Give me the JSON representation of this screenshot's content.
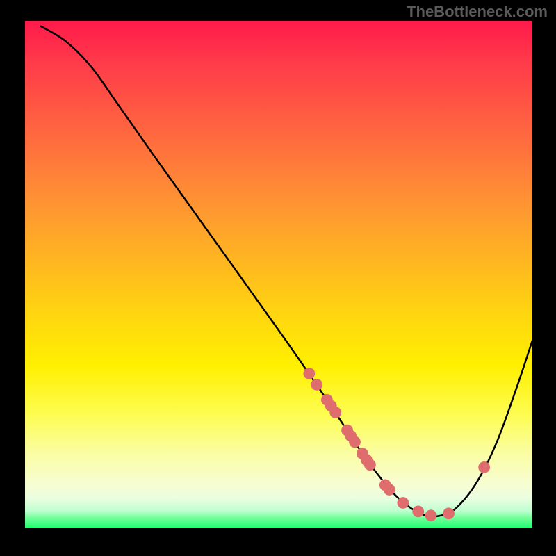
{
  "watermark": "TheBottleneck.com",
  "chart_data": {
    "type": "line",
    "title": "",
    "xlabel": "",
    "ylabel": "",
    "xlim": [
      0,
      100
    ],
    "ylim": [
      0,
      100
    ],
    "grid": false,
    "curve": [
      {
        "x": 3,
        "y": 99
      },
      {
        "x": 8,
        "y": 96
      },
      {
        "x": 13,
        "y": 91
      },
      {
        "x": 18,
        "y": 84
      },
      {
        "x": 25,
        "y": 74
      },
      {
        "x": 35,
        "y": 60
      },
      {
        "x": 50,
        "y": 39
      },
      {
        "x": 58,
        "y": 27.5
      },
      {
        "x": 61,
        "y": 23
      },
      {
        "x": 64,
        "y": 18.5
      },
      {
        "x": 67,
        "y": 14
      },
      {
        "x": 70,
        "y": 10
      },
      {
        "x": 73,
        "y": 6.5
      },
      {
        "x": 76,
        "y": 4
      },
      {
        "x": 79,
        "y": 2.5
      },
      {
        "x": 82,
        "y": 2.5
      },
      {
        "x": 85,
        "y": 4
      },
      {
        "x": 89,
        "y": 9
      },
      {
        "x": 93,
        "y": 17
      },
      {
        "x": 97,
        "y": 28
      },
      {
        "x": 100,
        "y": 37
      }
    ],
    "dots": [
      {
        "x": 56,
        "y": 30.5
      },
      {
        "x": 57.5,
        "y": 28.3
      },
      {
        "x": 59.5,
        "y": 25.3
      },
      {
        "x": 60.3,
        "y": 24.1
      },
      {
        "x": 61.2,
        "y": 22.8
      },
      {
        "x": 63.5,
        "y": 19.3
      },
      {
        "x": 64.2,
        "y": 18.2
      },
      {
        "x": 65.0,
        "y": 17.0
      },
      {
        "x": 66.5,
        "y": 14.7
      },
      {
        "x": 67.3,
        "y": 13.5
      },
      {
        "x": 68.0,
        "y": 12.5
      },
      {
        "x": 71.0,
        "y": 8.5
      },
      {
        "x": 71.8,
        "y": 7.6
      },
      {
        "x": 74.5,
        "y": 5.0
      },
      {
        "x": 77.5,
        "y": 3.3
      },
      {
        "x": 80.0,
        "y": 2.5
      },
      {
        "x": 83.5,
        "y": 2.9
      },
      {
        "x": 90.5,
        "y": 12.0
      }
    ],
    "colors": {
      "curve": "#000000",
      "dot_fill": "#e06d6d",
      "dot_stroke": "#e06d6d"
    }
  }
}
